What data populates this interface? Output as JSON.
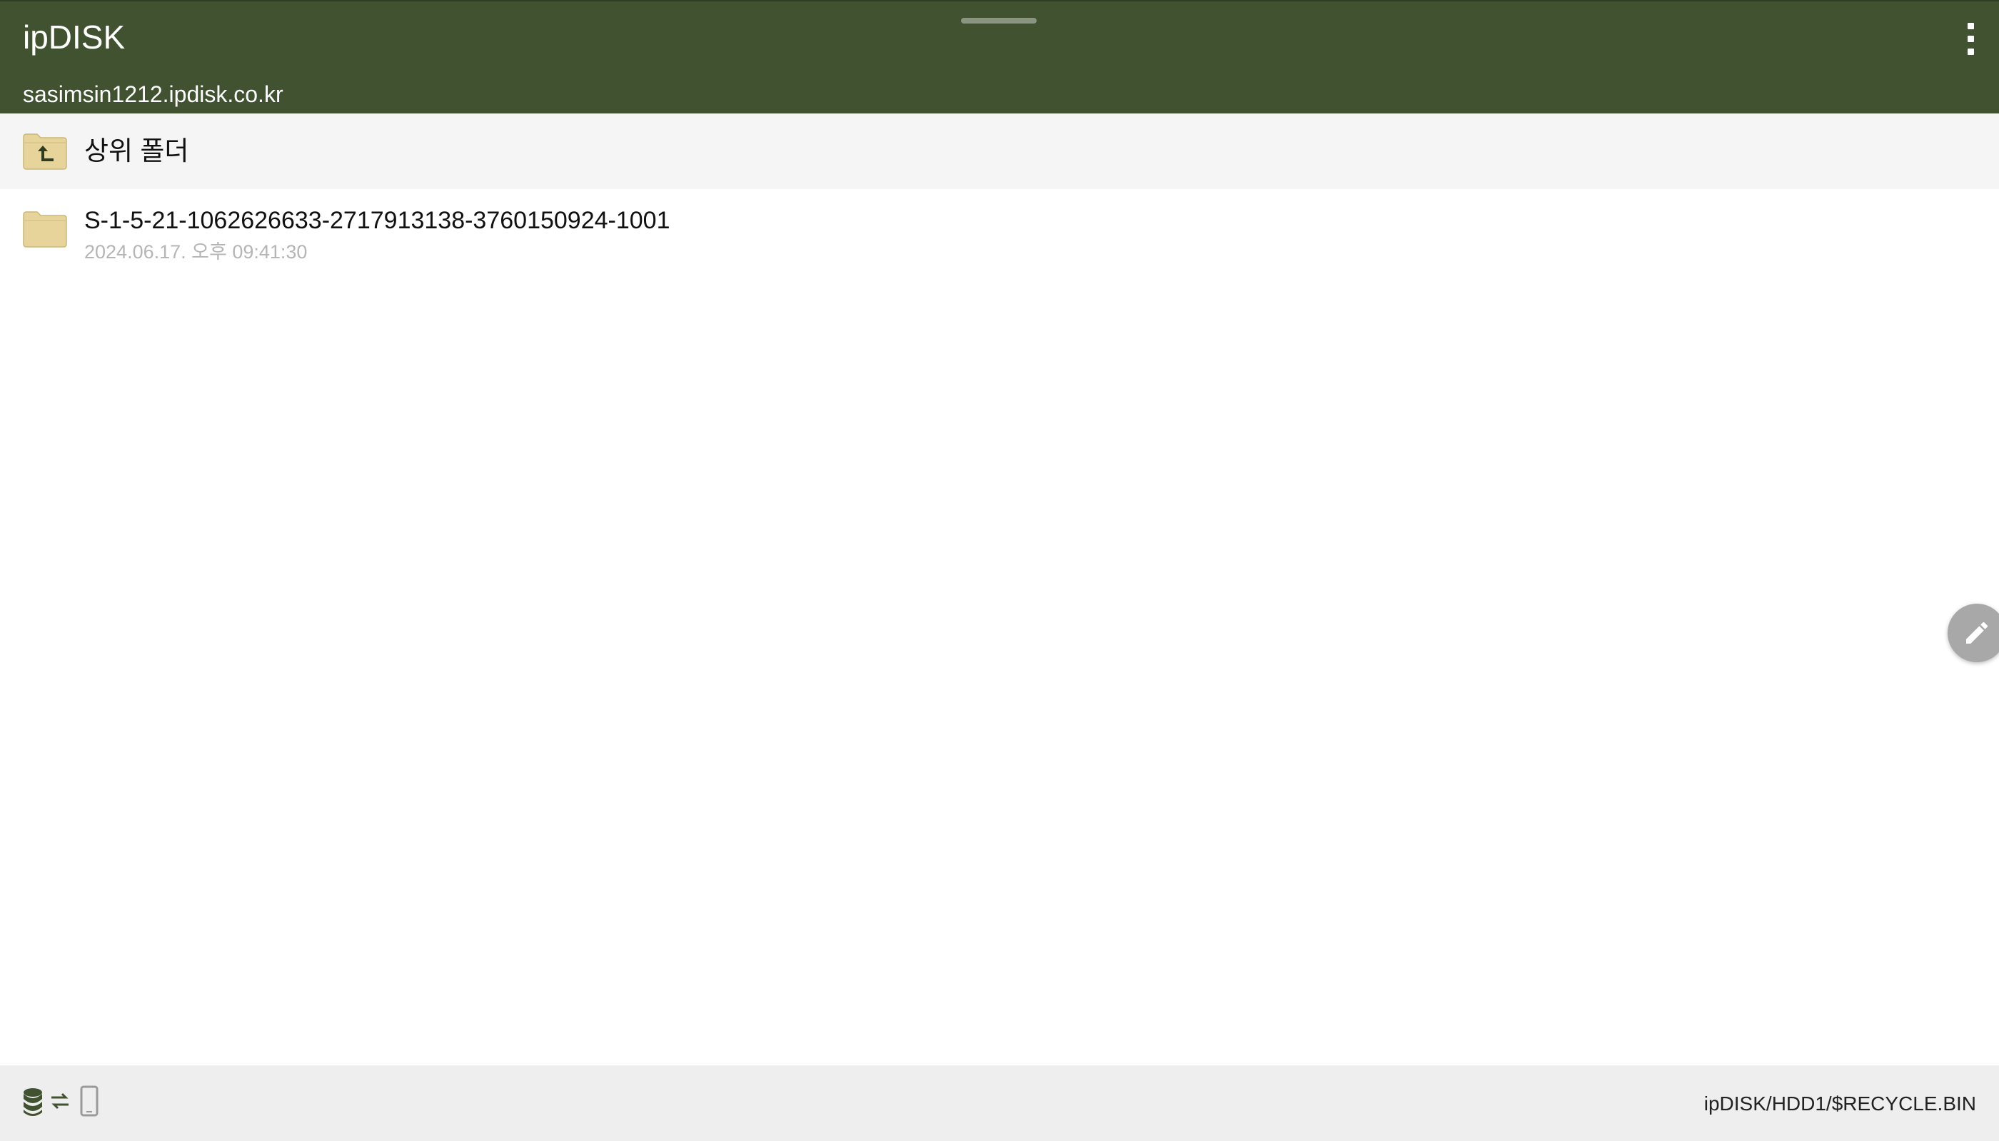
{
  "appbar": {
    "title": "ipDISK",
    "host": "sasimsin1212.ipdisk.co.kr",
    "background_color": "#405230",
    "menu_icon": "more-vert-icon"
  },
  "parent_row": {
    "label": "상위 폴더",
    "icon": "folder-up-icon"
  },
  "files": [
    {
      "name": "S-1-5-21-1062626633-2717913138-3760150924-1001",
      "date": "2024.06.17. 오후 09:41:30",
      "icon": "folder-icon"
    }
  ],
  "fab": {
    "icon": "edit-pencil-icon"
  },
  "bottombar": {
    "icons": [
      "storage-icon",
      "transfer-icon",
      "phone-icon"
    ],
    "path": "ipDISK/HDD1/$RECYCLE.BIN"
  }
}
